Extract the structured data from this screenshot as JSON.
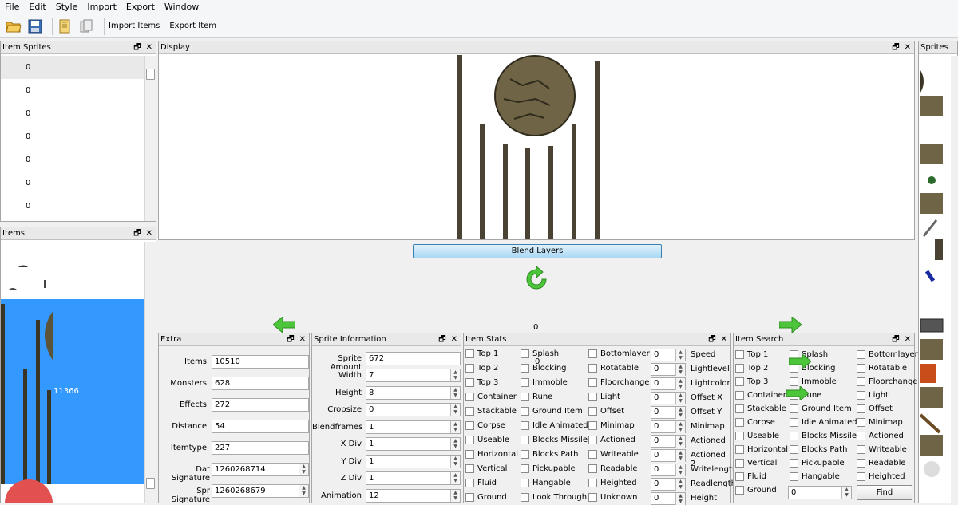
{
  "menu": [
    "File",
    "Edit",
    "Style",
    "Import",
    "Export",
    "Window"
  ],
  "toolbar": {
    "import_items": "Import Items",
    "export_item": "Export Item"
  },
  "item_sprites": {
    "title": "Item Sprites",
    "rows": [
      "0",
      "0",
      "0",
      "0",
      "0",
      "0",
      "0"
    ]
  },
  "items_panel": {
    "title": "Items",
    "selected_id": "11366"
  },
  "display": {
    "title": "Display",
    "blend_button": "Blend Layers",
    "frame_label": "0",
    "center_label": "0"
  },
  "sprites_panel": {
    "title": "Sprites"
  },
  "extra": {
    "title": "Extra",
    "fields": [
      {
        "label": "Items",
        "value": "10510"
      },
      {
        "label": "Monsters",
        "value": "628"
      },
      {
        "label": "Effects",
        "value": "272"
      },
      {
        "label": "Distance",
        "value": "54"
      },
      {
        "label": "Itemtype",
        "value": "227"
      },
      {
        "label": "Dat Signature",
        "value": "1260268714"
      },
      {
        "label": "Spr Signature",
        "value": "1260268679"
      }
    ]
  },
  "sprite_info": {
    "title": "Sprite Information",
    "fields": [
      {
        "label": "Sprite Amount",
        "value": "672"
      },
      {
        "label": "Width",
        "value": "7"
      },
      {
        "label": "Height",
        "value": "8"
      },
      {
        "label": "Cropsize",
        "value": "0"
      },
      {
        "label": "Blendframes",
        "value": "1"
      },
      {
        "label": "X Div",
        "value": "1"
      },
      {
        "label": "Y Div",
        "value": "1"
      },
      {
        "label": "Z Div",
        "value": "1"
      },
      {
        "label": "Animation",
        "value": "12"
      }
    ]
  },
  "item_stats": {
    "title": "Item Stats",
    "col1": [
      "Top 1",
      "Top 2",
      "Top 3",
      "Container",
      "Stackable",
      "Corpse",
      "Useable",
      "Horizontal",
      "Vertical",
      "Fluid",
      "Ground"
    ],
    "col2": [
      "Splash",
      "Blocking",
      "Immoble",
      "Rune",
      "Ground Item",
      "Idle Animated",
      "Blocks Missile",
      "Blocks Path",
      "Pickupable",
      "Hangable",
      "Look Through"
    ],
    "col3": [
      "Bottomlayer",
      "Rotatable",
      "Floorchange",
      "Light",
      "Offset",
      "Minimap",
      "Actioned",
      "Writeable",
      "Readable",
      "Heighted",
      "Unknown"
    ],
    "spin_values": [
      "0",
      "0",
      "0",
      "0",
      "0",
      "0",
      "0",
      "0",
      "0",
      "0",
      "0"
    ],
    "spin_labels": [
      "Speed",
      "Lightlevel",
      "Lightcolor",
      "Offset X",
      "Offset Y",
      "Minimap",
      "Actioned",
      "Actioned 2",
      "Writelength",
      "Readlength",
      "Height"
    ],
    "splash_sub": "0"
  },
  "item_search": {
    "title": "Item Search",
    "col1": [
      "Top 1",
      "Top 2",
      "Top 3",
      "Container",
      "Stackable",
      "Corpse",
      "Useable",
      "Horizontal",
      "Vertical",
      "Fluid",
      "Ground"
    ],
    "col2": [
      "Splash",
      "Blocking",
      "Immoble",
      "Rune",
      "Ground Item",
      "Idle Animated",
      "Blocks Missile",
      "Blocks Path",
      "Pickupable",
      "Hangable"
    ],
    "col3": [
      "Bottomlayer",
      "Rotatable",
      "Floorchange",
      "Light",
      "Offset",
      "Minimap",
      "Actioned",
      "Writeable",
      "Readable",
      "Heighted"
    ],
    "ground_value": "0",
    "find_button": "Find"
  },
  "colors": {
    "selection": "#3399ff",
    "arrow": "#4cc53a",
    "blend_btn": "#bfe2f8",
    "title_bg": "#e9e9e9"
  }
}
